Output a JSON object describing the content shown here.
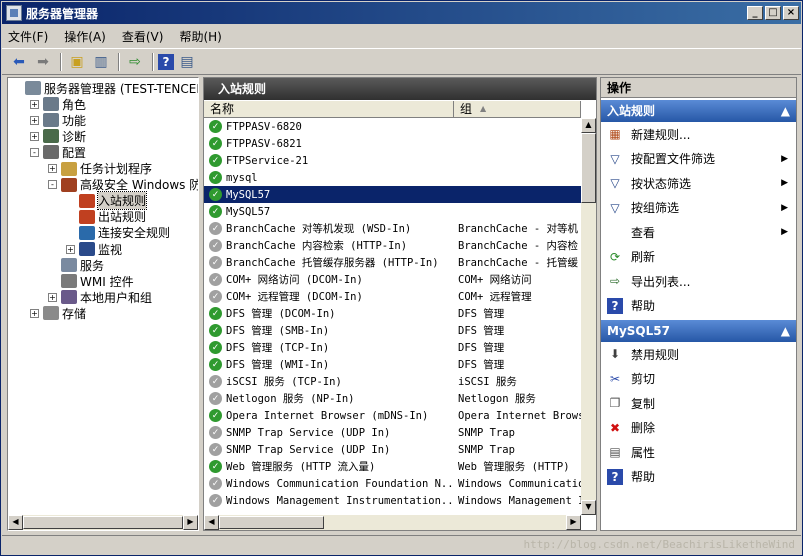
{
  "window": {
    "title": "服务器管理器"
  },
  "menu": [
    "文件(F)",
    "操作(A)",
    "查看(V)",
    "帮助(H)"
  ],
  "tree": [
    {
      "label": "服务器管理器 (TEST-TENCENT)",
      "level": 0,
      "exp": "",
      "icon": "server-icon"
    },
    {
      "label": "角色",
      "level": 1,
      "exp": "+",
      "icon": "roles-icon"
    },
    {
      "label": "功能",
      "level": 1,
      "exp": "+",
      "icon": "features-icon"
    },
    {
      "label": "诊断",
      "level": 1,
      "exp": "+",
      "icon": "diagnostics-icon"
    },
    {
      "label": "配置",
      "level": 1,
      "exp": "-",
      "icon": "config-icon"
    },
    {
      "label": "任务计划程序",
      "level": 2,
      "exp": "+",
      "icon": "clock-icon"
    },
    {
      "label": "高级安全 Windows 防火墙",
      "level": 2,
      "exp": "-",
      "icon": "firewall-icon"
    },
    {
      "label": "入站规则",
      "level": 3,
      "exp": "",
      "icon": "inbound-icon",
      "selected": true
    },
    {
      "label": "出站规则",
      "level": 3,
      "exp": "",
      "icon": "outbound-icon"
    },
    {
      "label": "连接安全规则",
      "level": 3,
      "exp": "",
      "icon": "connection-icon"
    },
    {
      "label": "监视",
      "level": 3,
      "exp": "+",
      "icon": "monitor-icon"
    },
    {
      "label": "服务",
      "level": 2,
      "exp": "",
      "icon": "services-icon"
    },
    {
      "label": "WMI 控件",
      "level": 2,
      "exp": "",
      "icon": "wmi-icon"
    },
    {
      "label": "本地用户和组",
      "level": 2,
      "exp": "+",
      "icon": "users-icon"
    },
    {
      "label": "存储",
      "level": 1,
      "exp": "+",
      "icon": "storage-icon"
    }
  ],
  "middle": {
    "title": "入站规则",
    "col_name": "名称",
    "col_group": "组"
  },
  "rules": [
    {
      "name": "FTPPASV-6820",
      "group": "",
      "enabled": true
    },
    {
      "name": "FTPPASV-6821",
      "group": "",
      "enabled": true
    },
    {
      "name": "FTPService-21",
      "group": "",
      "enabled": true
    },
    {
      "name": "mysql",
      "group": "",
      "enabled": true
    },
    {
      "name": "MySQL57",
      "group": "",
      "enabled": true,
      "selected": true
    },
    {
      "name": "MySQL57",
      "group": "",
      "enabled": true
    },
    {
      "name": "BranchCache 对等机发现 (WSD-In)",
      "group": "BranchCache - 对等机",
      "enabled": false
    },
    {
      "name": "BranchCache 内容检索 (HTTP-In)",
      "group": "BranchCache - 内容检",
      "enabled": false
    },
    {
      "name": "BranchCache 托管缓存服务器 (HTTP-In)",
      "group": "BranchCache - 托管缓",
      "enabled": false
    },
    {
      "name": "COM+ 网络访问 (DCOM-In)",
      "group": "COM+ 网络访问",
      "enabled": false
    },
    {
      "name": "COM+ 远程管理 (DCOM-In)",
      "group": "COM+ 远程管理",
      "enabled": false
    },
    {
      "name": "DFS 管理 (DCOM-In)",
      "group": "DFS 管理",
      "enabled": true
    },
    {
      "name": "DFS 管理 (SMB-In)",
      "group": "DFS 管理",
      "enabled": true
    },
    {
      "name": "DFS 管理 (TCP-In)",
      "group": "DFS 管理",
      "enabled": true
    },
    {
      "name": "DFS 管理 (WMI-In)",
      "group": "DFS 管理",
      "enabled": true
    },
    {
      "name": "iSCSI 服务 (TCP-In)",
      "group": "iSCSI 服务",
      "enabled": false
    },
    {
      "name": "Netlogon 服务 (NP-In)",
      "group": "Netlogon 服务",
      "enabled": false
    },
    {
      "name": "Opera Internet Browser (mDNS-In)",
      "group": "Opera Internet Brows",
      "enabled": true
    },
    {
      "name": "SNMP Trap Service (UDP In)",
      "group": "SNMP Trap",
      "enabled": false
    },
    {
      "name": "SNMP Trap Service (UDP In)",
      "group": "SNMP Trap",
      "enabled": false
    },
    {
      "name": "Web 管理服务 (HTTP 流入量)",
      "group": "Web 管理服务 (HTTP)",
      "enabled": true
    },
    {
      "name": "Windows Communication Foundation N...",
      "group": "Windows Communicatio",
      "enabled": false
    },
    {
      "name": "Windows Management Instrumentation...",
      "group": "Windows Management I",
      "enabled": false
    }
  ],
  "actions": {
    "header": "操作",
    "section1": "入站规则",
    "items1": [
      {
        "label": "新建规则...",
        "icon": "new-rule-icon",
        "glyph": "▦",
        "color": "#b04a1a",
        "arrow": ""
      },
      {
        "label": "按配置文件筛选",
        "icon": "filter-icon",
        "glyph": "▽",
        "color": "#2a4a8a",
        "arrow": "▶"
      },
      {
        "label": "按状态筛选",
        "icon": "filter-icon",
        "glyph": "▽",
        "color": "#2a4a8a",
        "arrow": "▶"
      },
      {
        "label": "按组筛选",
        "icon": "filter-icon",
        "glyph": "▽",
        "color": "#2a4a8a",
        "arrow": "▶"
      },
      {
        "label": "查看",
        "icon": "view-icon",
        "glyph": "",
        "color": "#000",
        "arrow": "▶"
      },
      {
        "label": "刷新",
        "icon": "refresh-icon",
        "glyph": "⟳",
        "color": "#2a8a2a",
        "arrow": ""
      },
      {
        "label": "导出列表...",
        "icon": "export-icon",
        "glyph": "⇨",
        "color": "#2a6a2a",
        "arrow": ""
      },
      {
        "label": "帮助",
        "icon": "help-icon",
        "glyph": "?",
        "color": "#1a3a9a",
        "arrow": ""
      }
    ],
    "section2": "MySQL57",
    "items2": [
      {
        "label": "禁用规则",
        "icon": "disable-icon",
        "glyph": "⬇",
        "color": "#404040"
      },
      {
        "label": "剪切",
        "icon": "cut-icon",
        "glyph": "✂",
        "color": "#2a4aaa"
      },
      {
        "label": "复制",
        "icon": "copy-icon",
        "glyph": "❐",
        "color": "#505050"
      },
      {
        "label": "删除",
        "icon": "delete-icon",
        "glyph": "✖",
        "color": "#d01010"
      },
      {
        "label": "属性",
        "icon": "properties-icon",
        "glyph": "▤",
        "color": "#505050"
      },
      {
        "label": "帮助",
        "icon": "help-icon",
        "glyph": "?",
        "color": "#1a3a9a"
      }
    ]
  },
  "status": {
    "watermark": "http://blog.csdn.net/BeachirisLiketheWind"
  }
}
